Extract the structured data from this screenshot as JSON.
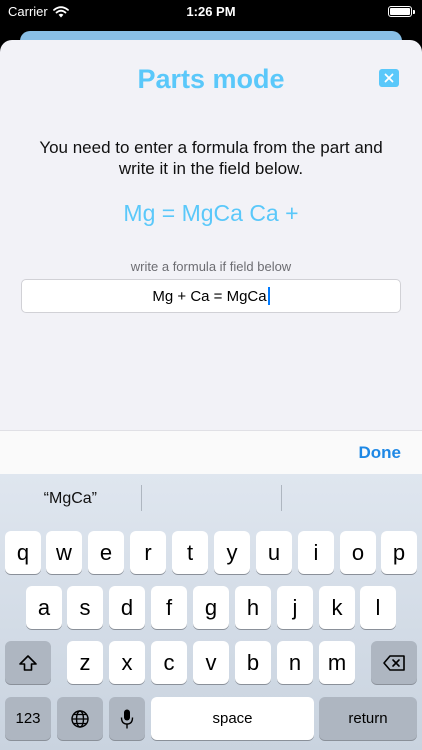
{
  "status_bar": {
    "carrier": "Carrier",
    "time": "1:26 PM"
  },
  "sheet": {
    "title": "Parts mode",
    "close_icon": "close-icon",
    "instruction": "You need to enter a formula from the part and write it in the field below.",
    "formula": "Mg = MgCa Ca +",
    "hint": "write a formula if field below",
    "answer_value": "Mg + Ca = MgCa"
  },
  "toolbar": {
    "done_label": "Done"
  },
  "keyboard": {
    "suggestions": [
      "“MgCa”",
      "",
      ""
    ],
    "row1": [
      "q",
      "w",
      "e",
      "r",
      "t",
      "y",
      "u",
      "i",
      "o",
      "p"
    ],
    "row2": [
      "a",
      "s",
      "d",
      "f",
      "g",
      "h",
      "j",
      "k",
      "l"
    ],
    "row3": [
      "z",
      "x",
      "c",
      "v",
      "b",
      "n",
      "m"
    ],
    "numbers_label": "123",
    "space_label": "space",
    "return_label": "return"
  },
  "colors": {
    "accent": "#5ac8fa",
    "done": "#1e88e5"
  }
}
